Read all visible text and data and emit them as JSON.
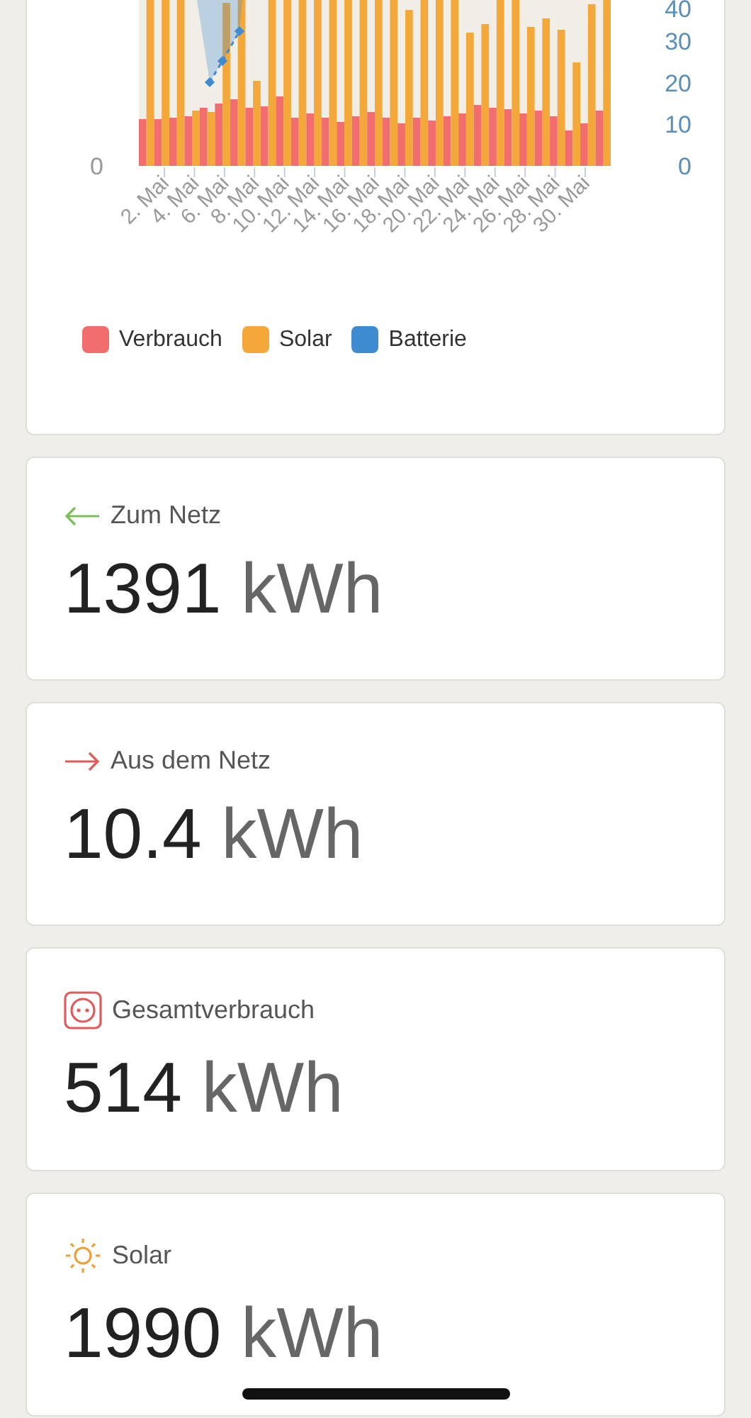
{
  "chart": {
    "y_axis_left": {
      "ticks": [
        "0"
      ]
    },
    "y_axis_right": {
      "ticks": [
        "40",
        "30",
        "20",
        "10",
        "0"
      ]
    },
    "x_axis": {
      "labels": [
        "2. Mai",
        "4. Mai",
        "6. Mai",
        "8. Mai",
        "10. Mai",
        "12. Mai",
        "14. Mai",
        "16. Mai",
        "18. Mai",
        "20. Mai",
        "22. Mai",
        "24. Mai",
        "26. Mai",
        "28. Mai",
        "30. Mai"
      ]
    },
    "legend": [
      {
        "label": "Verbrauch",
        "color": "#f26d6d"
      },
      {
        "label": "Solar",
        "color": "#f4a83a"
      },
      {
        "label": "Batterie",
        "color": "#3f8bd0"
      }
    ]
  },
  "stats": [
    {
      "kind": "to_grid",
      "label": "Zum Netz",
      "value": "1391",
      "unit": "kWh"
    },
    {
      "kind": "from_grid",
      "label": "Aus dem Netz",
      "value": "10.4",
      "unit": "kWh"
    },
    {
      "kind": "consumption",
      "label": "Gesamtverbrauch",
      "value": "514",
      "unit": "kWh"
    },
    {
      "kind": "solar",
      "label": "Solar",
      "value": "1990",
      "unit": "kWh"
    }
  ]
}
